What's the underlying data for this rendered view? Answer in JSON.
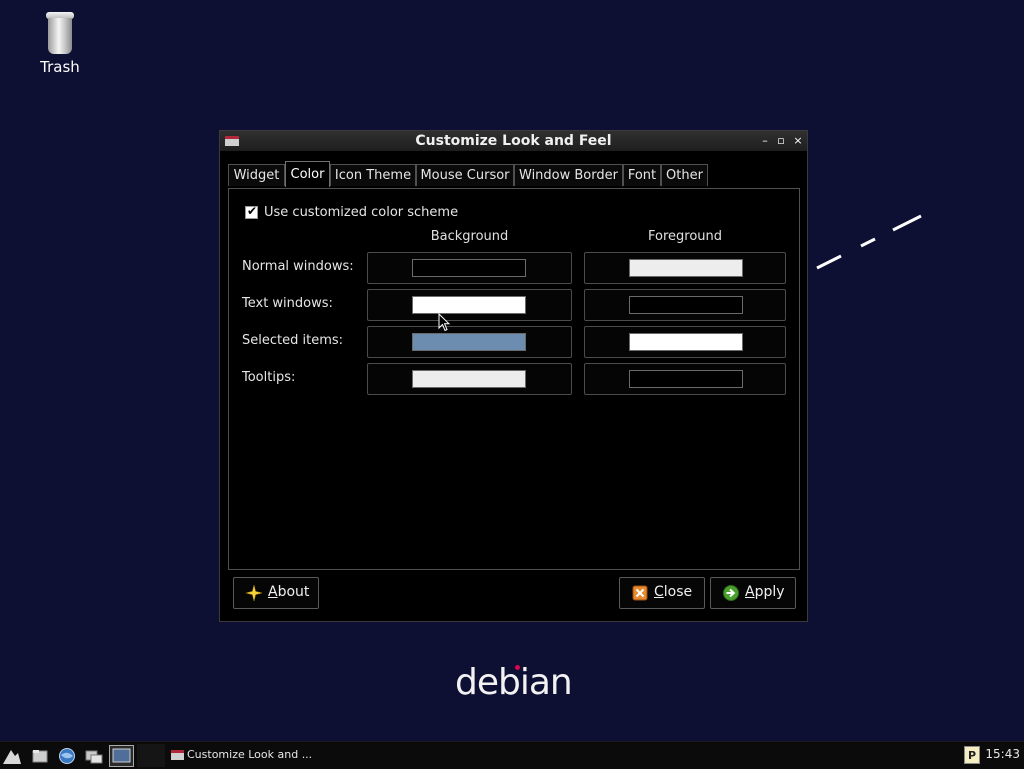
{
  "desktop": {
    "trash_label": "Trash",
    "brand": "debian"
  },
  "window": {
    "title": "Customize Look and Feel",
    "controls": {
      "minimize": "–",
      "maximize": "▫",
      "close": "×"
    },
    "tabs": [
      {
        "label": "Widget",
        "active": false
      },
      {
        "label": "Color",
        "active": true
      },
      {
        "label": "Icon Theme",
        "active": false
      },
      {
        "label": "Mouse Cursor",
        "active": false
      },
      {
        "label": "Window Border",
        "active": false
      },
      {
        "label": "Font",
        "active": false
      },
      {
        "label": "Other",
        "active": false
      }
    ],
    "color_tab": {
      "use_custom_label": "Use customized color scheme",
      "use_custom_checked": true,
      "col_background": "Background",
      "col_foreground": "Foreground",
      "rows": [
        {
          "label": "Normal windows:",
          "background": "#000000",
          "foreground": "#ededed"
        },
        {
          "label": "Text windows:",
          "background": "#ffffff",
          "foreground": "#000000"
        },
        {
          "label": "Selected items:",
          "background": "#6c8cb0",
          "foreground": "#ffffff"
        },
        {
          "label": "Tooltips:",
          "background": "#ededed",
          "foreground": "#000000"
        }
      ]
    },
    "buttons": {
      "about": "About",
      "close": "Close",
      "apply": "Apply"
    }
  },
  "taskbar": {
    "task_title": "Customize Look and ...",
    "tray_p": "P",
    "clock": "15:43"
  }
}
